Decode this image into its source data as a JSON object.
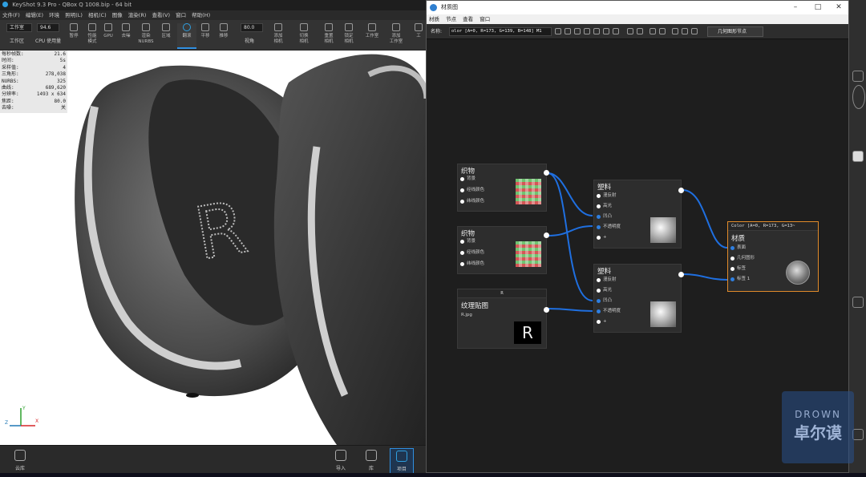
{
  "main_window": {
    "title": "KeyShot 9.3 Pro  - QBox Q 1008.bip  - 64 bit",
    "menu": [
      "文件(F)",
      "编辑(E)",
      "环境",
      "照明(L)",
      "相机(C)",
      "图像",
      "渲染(R)",
      "查看(V)",
      "窗口",
      "帮助(H)"
    ],
    "toolbar": {
      "workspace_value": "工作室",
      "workspace_label": "工作区",
      "cpu_value": "94.6",
      "cpu_label": "CPU 使用量",
      "pause_label": "暂停",
      "perf_label": "性能\n模式",
      "gpu_label": "GPU",
      "denoise_label": "去噪",
      "render_label": "渲染\nNURBS",
      "region_label": "区域",
      "tumble_label": "翻滚",
      "pan_label": "平移",
      "dolly_label": "推移",
      "fov_value": "80.0",
      "fov_label": "视角",
      "add_camera_label": "添加\n相机",
      "switch_camera_label": "切换\n相机",
      "reset_camera_label": "重置\n相机",
      "lock_camera_label": "锁定\n相机",
      "studio_label": "工作室",
      "add_studio_label": "添加\n工作室",
      "more_label": "工"
    },
    "stats": [
      {
        "k": "每秒帧数:",
        "v": "21.6"
      },
      {
        "k": "时间:",
        "v": "5s"
      },
      {
        "k": "采样值:",
        "v": "4"
      },
      {
        "k": "三角形:",
        "v": "278,038"
      },
      {
        "k": "NURBS:",
        "v": "325"
      },
      {
        "k": "曲线:",
        "v": "689,620"
      },
      {
        "k": "分辨率:",
        "v": "1493 x 634"
      },
      {
        "k": "焦距:",
        "v": "80.0"
      },
      {
        "k": "去噪:",
        "v": "关"
      }
    ],
    "axis": {
      "x": "X",
      "y": "Y",
      "z": "Z"
    },
    "bottom": {
      "cloud_label": "云库",
      "import_label": "导入",
      "library_label": "库",
      "project_label": "项目"
    }
  },
  "material_graph": {
    "title": "材质图",
    "menu": [
      "材质",
      "节点",
      "查看",
      "窗口"
    ],
    "name_label": "名称:",
    "name_value": "olor [A=0, R=173, G=139, B=148] M1",
    "add_node_label": "几何图形节点",
    "nodes": {
      "weave1": {
        "title": "织物",
        "ports": [
          "背景",
          "经线颜色",
          "纬线颜色"
        ]
      },
      "weave2": {
        "title": "织物",
        "ports": [
          "背景",
          "经线颜色",
          "纬线颜色"
        ]
      },
      "texture": {
        "header": "R",
        "title": "纹理贴图",
        "file": "R.jpg",
        "preview": "R"
      },
      "plastic1": {
        "title": "塑料",
        "ports": [
          "漫反射",
          "高光",
          "凹凸",
          "不透明度",
          "+"
        ]
      },
      "plastic2": {
        "title": "塑料",
        "ports": [
          "漫反射",
          "高光",
          "凹凸",
          "不透明度",
          "+"
        ]
      },
      "material": {
        "header": "Color [A=0, R=173, G=13~",
        "title": "材质",
        "ports": [
          "表面",
          "几何图形",
          "标签",
          "标签 1"
        ]
      }
    }
  },
  "watermark": {
    "line1": "DROWN",
    "line2": "卓尔谟"
  },
  "colors": {
    "accent": "#2f8fe0",
    "material_border": "#e08a2a",
    "wire": "#1f6fe0"
  }
}
